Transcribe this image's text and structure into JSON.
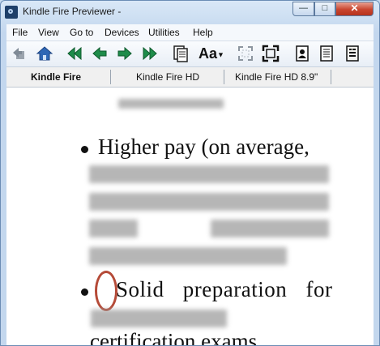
{
  "window": {
    "title": "Kindle Fire Previewer -"
  },
  "titlebar": {
    "min_glyph": "—",
    "max_glyph": "□",
    "close_glyph": "✕"
  },
  "menu": {
    "items": [
      "File",
      "View",
      "Go to",
      "Devices",
      "Utilities",
      "Help"
    ]
  },
  "toolbar": {
    "buttons": [
      "undo-icon",
      "home-icon",
      "first-page-icon",
      "previous-page-icon",
      "next-page-icon",
      "last-page-icon",
      "table-of-contents-icon",
      "font-size-icon",
      "fit-screen-icon",
      "full-screen-icon",
      "portrait-icon",
      "page-view-icon",
      "sepia-page-icon"
    ],
    "font_label": "Aa"
  },
  "tabs": {
    "items": [
      "Kindle Fire",
      "Kindle Fire HD",
      "Kindle Fire HD 8.9\""
    ],
    "active": 0
  },
  "content": {
    "bullet1_text": "Higher pay (on average,",
    "bullet2_text": "Solid preparation for",
    "bottom_text": "certification exams",
    "highlight_color": "#b54a37"
  }
}
